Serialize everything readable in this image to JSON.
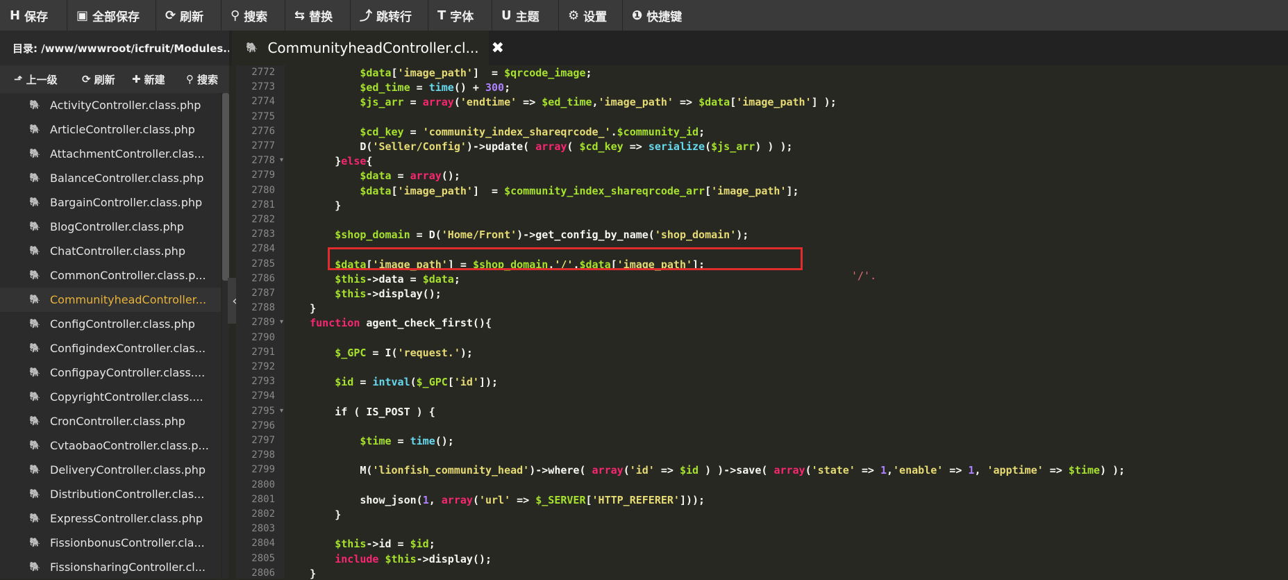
{
  "toolbar": {
    "buttons": [
      {
        "icon": "H",
        "label": "保存"
      },
      {
        "icon": "▣",
        "label": "全部保存"
      },
      {
        "icon": "⟳",
        "label": "刷新"
      },
      {
        "icon": "⚲",
        "label": "搜索"
      },
      {
        "icon": "⇆",
        "label": "替换"
      },
      {
        "icon": "⤴",
        "label": "跳转行"
      },
      {
        "icon": "T",
        "label": "字体"
      },
      {
        "icon": "U",
        "label": "主题"
      },
      {
        "icon": "⚙",
        "label": "设置"
      },
      {
        "icon": "❶",
        "label": "快捷键"
      }
    ]
  },
  "directory": {
    "label": "目录: /www/wwwroot/icfruit/Modules..."
  },
  "tab": {
    "label": "CommunityheadController.cl...",
    "close": "✖"
  },
  "actions": [
    {
      "icon": "⬏",
      "label": "上一级"
    },
    {
      "icon": "⟳",
      "label": "刷新"
    },
    {
      "icon": "✚",
      "label": "新建"
    },
    {
      "icon": "⚲",
      "label": "搜索"
    }
  ],
  "files": [
    "ActivityController.class.php",
    "ArticleController.class.php",
    "AttachmentController.clas...",
    "BalanceController.class.php",
    "BargainController.class.php",
    "BlogController.class.php",
    "ChatController.class.php",
    "CommonController.class.p...",
    "CommunityheadController...",
    "ConfigController.class.php",
    "ConfigindexController.clas...",
    "ConfigpayController.class....",
    "CopyrightController.class....",
    "CronController.class.php",
    "CvtaobaoController.class.p...",
    "DeliveryController.class.php",
    "DistributionController.clas...",
    "ExpressController.class.php",
    "FissionbonusController.cla...",
    "FissionsharingController.cl..."
  ],
  "active_file_index": 8,
  "line_numbers": [
    "2772",
    "2773",
    "2774",
    "2775",
    "2776",
    "2777",
    "2778",
    "2779",
    "2780",
    "2781",
    "2782",
    "2783",
    "2784",
    "2785",
    "2786",
    "2787",
    "2788",
    "2789",
    "2790",
    "2791",
    "2792",
    "2793",
    "2794",
    "2795",
    "2796",
    "2797",
    "2798",
    "2799",
    "2800",
    "2801",
    "2802",
    "2803",
    "2804",
    "2805",
    "2806"
  ],
  "code_lines": [
    "            $data['image_path']  = $qrcode_image;",
    "            $ed_time = time() + 300;",
    "            $js_arr = array('endtime' => $ed_time,'image_path' => $data['image_path'] );",
    "",
    "            $cd_key = 'community_index_shareqrcode_'.$community_id;",
    "            D('Seller/Config')->update( array( $cd_key => serialize($js_arr) ) );",
    "        }else{",
    "            $data = array();",
    "            $data['image_path']  = $community_index_shareqrcode_arr['image_path'];",
    "        }",
    "",
    "        $shop_domain = D('Home/Front')->get_config_by_name('shop_domain');",
    "",
    "        $data['image_path'] = $shop_domain.'/'.$data['image_path'];",
    "        $this->data = $data;",
    "        $this->display();",
    "    }",
    "    function agent_check_first(){",
    "",
    "        $_GPC = I('request.');",
    "",
    "        $id = intval($_GPC['id']);",
    "",
    "        if ( IS_POST ) {",
    "",
    "            $time = time();",
    "",
    "            M('lionfish_community_head')->where( array('id' => $id ) )->save( array('state' => 1,'enable' => 1, 'apptime' => $time) );",
    "",
    "            show_json(1, array('url' => $_SERVER['HTTP_REFERER']));",
    "        }",
    "",
    "        $this->id = $id;",
    "        include $this->display();",
    "    }"
  ],
  "stray_text": "'/'.",
  "colors": {
    "accent": "#e8b33a",
    "highlight_border": "#e02c2c",
    "editor_bg": "#272822"
  }
}
